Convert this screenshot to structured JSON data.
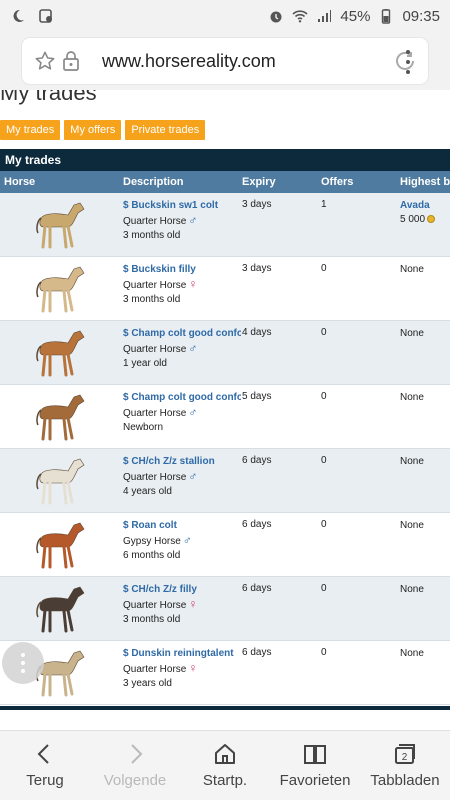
{
  "status_bar": {
    "battery": "45%",
    "time": "09:35"
  },
  "browser": {
    "url": "www.horsereality.com"
  },
  "page": {
    "title": "My trades",
    "tabs": [
      {
        "label": "My trades"
      },
      {
        "label": "My offers"
      },
      {
        "label": "Private trades"
      }
    ],
    "section_title": "My trades",
    "columns": [
      "Horse",
      "Description",
      "Expiry",
      "Offers",
      "Highest bi"
    ],
    "rows": [
      {
        "title": "$ Buckskin sw1 colt",
        "breed": "Quarter Horse",
        "gender": "♂",
        "gender_type": "m",
        "age": "3 months old",
        "expiry": "3 days",
        "offers": "1",
        "bid_name": "Avada",
        "bid_value": "5 000",
        "coat": "#c9a86e"
      },
      {
        "title": "$ Buckskin filly",
        "breed": "Quarter Horse",
        "gender": "♀",
        "gender_type": "f",
        "age": "3 months old",
        "expiry": "3 days",
        "offers": "0",
        "bid_text": "None",
        "coat": "#d6b98a"
      },
      {
        "title": "$ Champ colt good confo",
        "breed": "Quarter Horse",
        "gender": "♂",
        "gender_type": "m",
        "age": "1 year old",
        "expiry": "4 days",
        "offers": "0",
        "bid_text": "None",
        "coat": "#b8733a"
      },
      {
        "title": "$ Champ colt good confo",
        "breed": "Quarter Horse",
        "gender": "♂",
        "gender_type": "m",
        "age": "Newborn",
        "expiry": "5 days",
        "offers": "0",
        "bid_text": "None",
        "coat": "#a36a3a"
      },
      {
        "title": "$ CH/ch Z/z stallion",
        "breed": "Quarter Horse",
        "gender": "♂",
        "gender_type": "m",
        "age": "4 years old",
        "expiry": "6 days",
        "offers": "0",
        "bid_text": "None",
        "coat": "#e6e0d3"
      },
      {
        "title": "$ Roan colt",
        "breed": "Gypsy Horse",
        "gender": "♂",
        "gender_type": "m",
        "age": "6 months old",
        "expiry": "6 days",
        "offers": "0",
        "bid_text": "None",
        "coat": "#b5582a"
      },
      {
        "title": "$ CH/ch Z/z filly",
        "breed": "Quarter Horse",
        "gender": "♀",
        "gender_type": "f",
        "age": "3 months old",
        "expiry": "6 days",
        "offers": "0",
        "bid_text": "None",
        "coat": "#4a3d35"
      },
      {
        "title": "$ Dunskin reiningtalent",
        "breed": "Quarter Horse",
        "gender": "♀",
        "gender_type": "f",
        "age": "3 years old",
        "expiry": "6 days",
        "offers": "0",
        "bid_text": "None",
        "coat": "#c8b38c"
      }
    ]
  },
  "bottom_nav": [
    {
      "label": "Terug",
      "icon": "back-icon",
      "enabled": true
    },
    {
      "label": "Volgende",
      "icon": "forward-icon",
      "enabled": false
    },
    {
      "label": "Startp.",
      "icon": "home-icon",
      "enabled": true
    },
    {
      "label": "Favorieten",
      "icon": "bookmarks-icon",
      "enabled": true
    },
    {
      "label": "Tabbladen",
      "icon": "tabs-icon",
      "enabled": true,
      "badge": "2"
    }
  ]
}
